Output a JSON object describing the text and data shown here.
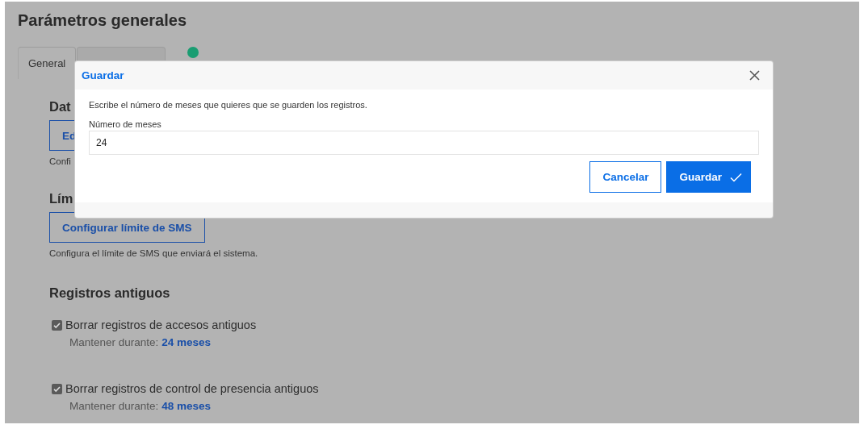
{
  "page": {
    "title": "Parámetros generales",
    "tabs": [
      {
        "label": "General",
        "selected": true
      },
      {
        "selected": false
      }
    ],
    "sections": [
      {
        "heading": "Dat",
        "button": "Ed",
        "description": "Confi"
      },
      {
        "heading": "Lím",
        "button": "Configurar límite de SMS",
        "description": "Configura el límite de SMS que enviará el sistema."
      }
    ],
    "old_records": {
      "heading": "Registros antiguos",
      "items": [
        {
          "label": "Borrar registros de accesos antiguos",
          "checked": true,
          "keep_label": "Mantener durante:",
          "keep_value": "24 meses"
        },
        {
          "label": "Borrar registros de control de presencia antiguos",
          "checked": true,
          "keep_label": "Mantener durante:",
          "keep_value": "48 meses"
        }
      ]
    }
  },
  "dialog": {
    "title": "Guardar",
    "description": "Escribe el número de meses que quieres que se guarden los registros.",
    "field": {
      "label": "Número de meses",
      "value": "24"
    },
    "buttons": [
      {
        "label": "Cancelar",
        "kind": "secondary"
      },
      {
        "label": "Guardar",
        "kind": "primary"
      }
    ]
  }
}
